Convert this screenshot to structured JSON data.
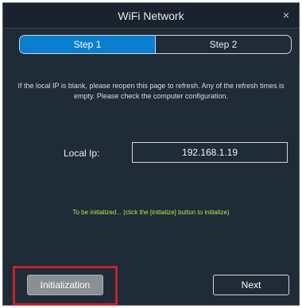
{
  "window": {
    "title": "WiFi Network",
    "close_icon": "×"
  },
  "steps": {
    "step1_label": "Step 1",
    "step2_label": "Step 2",
    "active": "Step 1"
  },
  "info": {
    "line1": "If the local IP is blank, please reopen this page to refresh. Any of the refresh times is",
    "line2": "empty. Please check the computer configuration."
  },
  "local_ip": {
    "label": "Local Ip:",
    "value": "192.168.1.19"
  },
  "status": {
    "text": "To be initialized... (click the [initialize] button to initialize)"
  },
  "buttons": {
    "init_label": "Initialization",
    "next_label": "Next"
  },
  "colors": {
    "background": "#1f2b37",
    "active_step": "#0a7ecf",
    "status_text": "#b8e64a",
    "highlight": "#c0242b"
  }
}
